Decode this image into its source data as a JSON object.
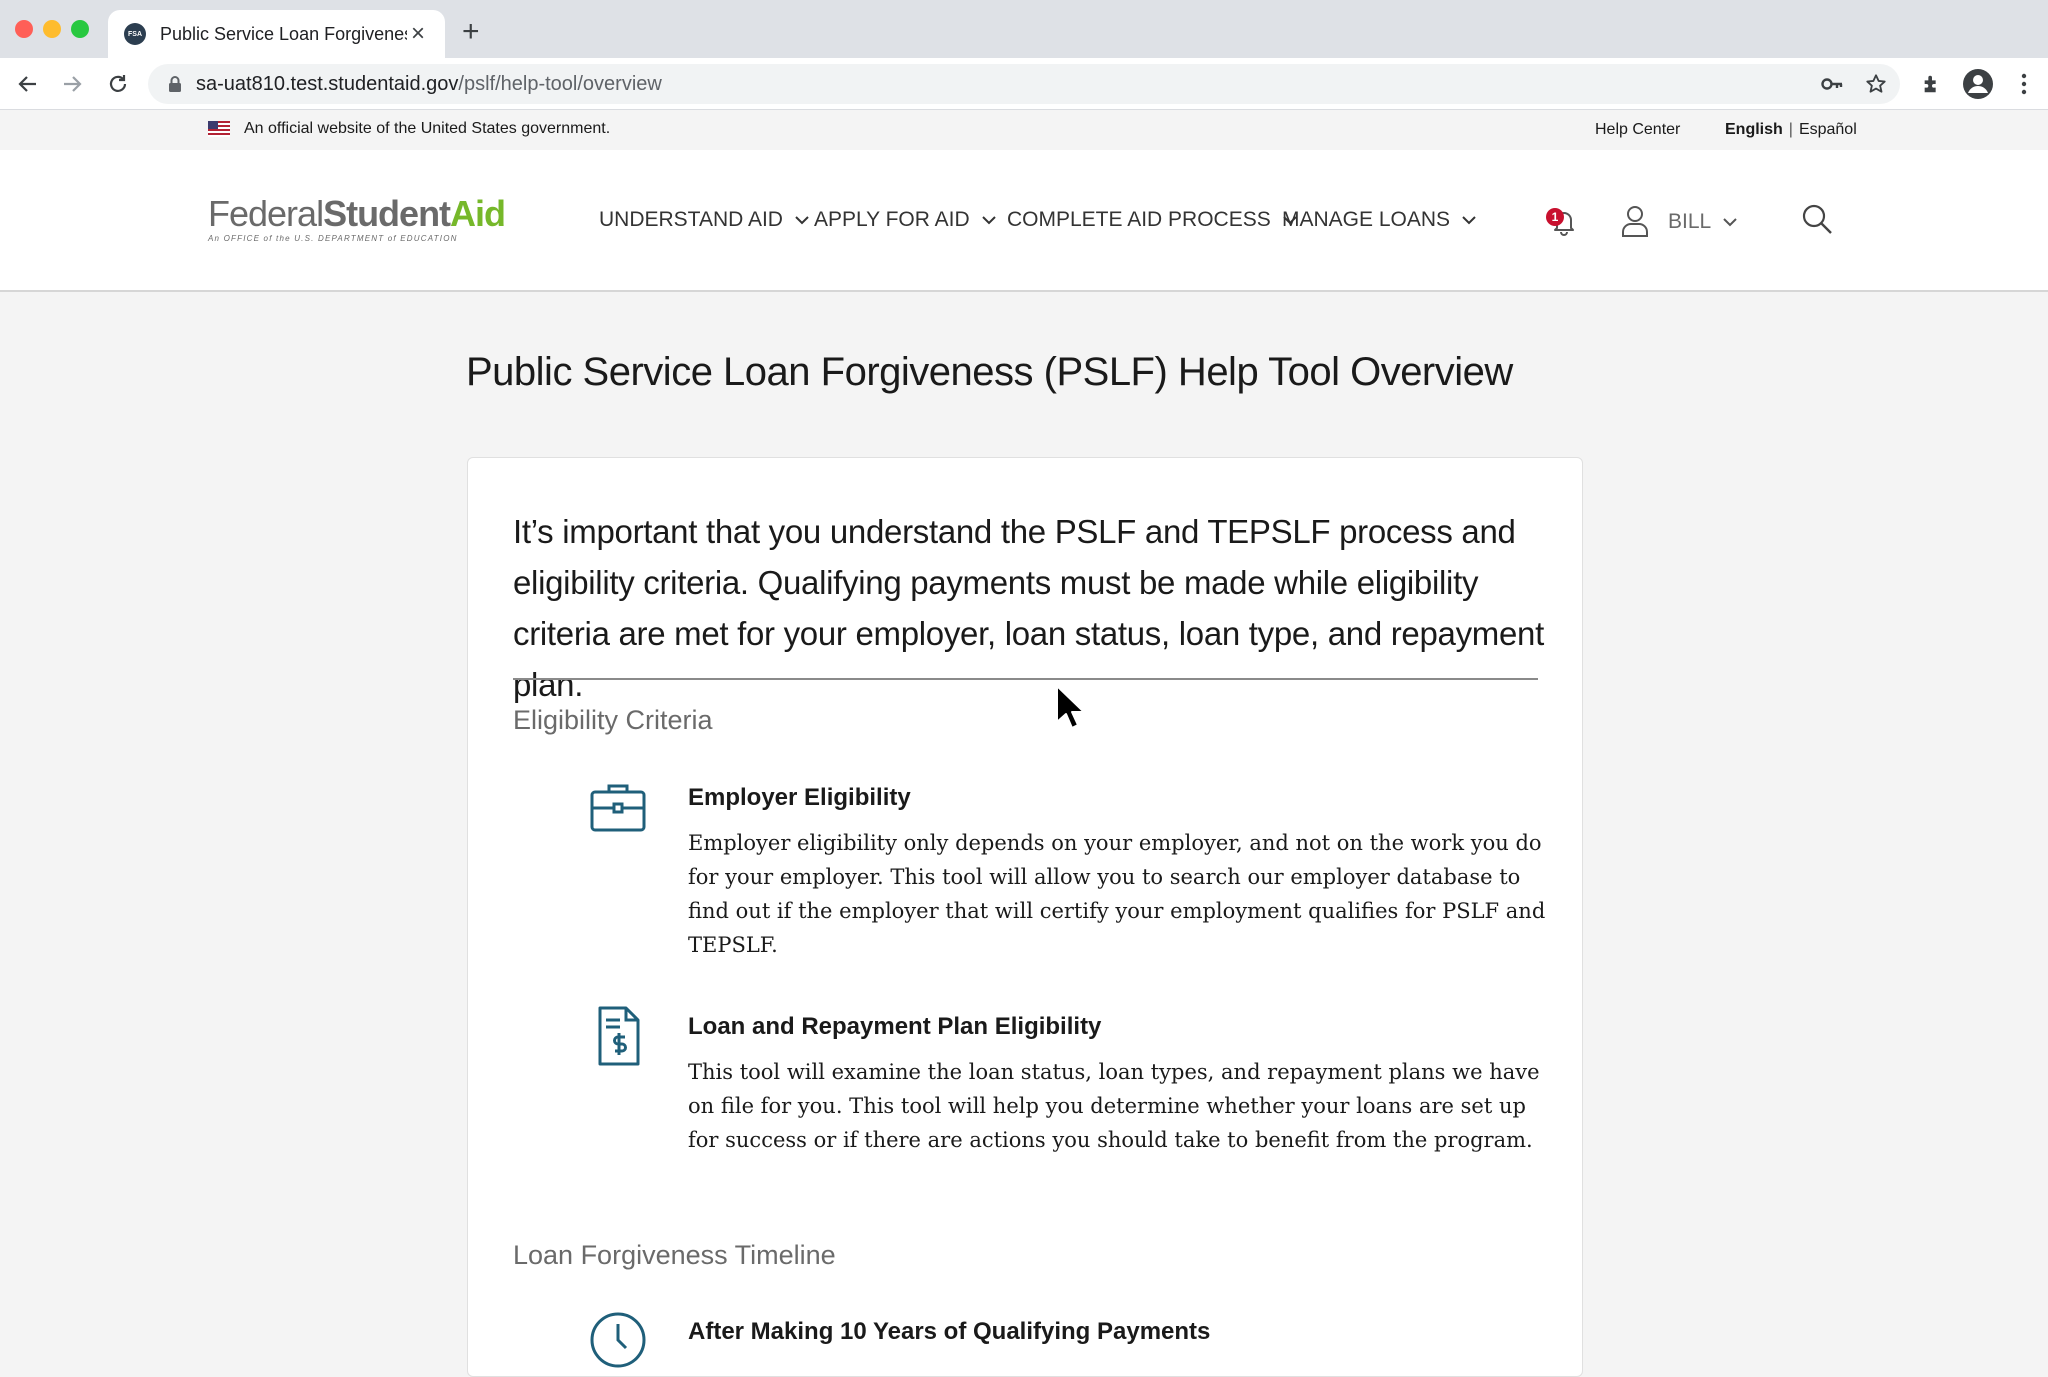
{
  "browser": {
    "tab_title": "Public Service Loan Forgiveness",
    "tab_favicon": "FSA",
    "url_host": "sa-uat810.test.studentaid.gov",
    "url_path": "/pslf/help-tool/overview"
  },
  "gov_banner": {
    "text": "An official website of the United States government.",
    "help_center": "Help Center",
    "lang_english": "English",
    "lang_sep": "|",
    "lang_spanish": "Español"
  },
  "header": {
    "logo_federal": "Federal",
    "logo_student": "Student",
    "logo_aid": "Aid",
    "logo_sub": "An OFFICE of the U.S. DEPARTMENT of EDUCATION",
    "nav": [
      {
        "label": "UNDERSTAND AID"
      },
      {
        "label": "APPLY FOR AID"
      },
      {
        "label": "COMPLETE AID PROCESS"
      },
      {
        "label": "MANAGE LOANS"
      }
    ],
    "notification_count": "1",
    "user_name": "BILL"
  },
  "page": {
    "title": "Public Service Loan Forgiveness (PSLF) Help Tool Overview",
    "intro": "It’s important that you understand the PSLF and TEPSLF process and eligibility criteria. Qualifying payments must be made while eligibility criteria are met for your employer, loan status, loan type, and repayment plan.",
    "eligibility_label": "Eligibility Criteria",
    "employer_title": "Employer Eligibility",
    "employer_body": "Employer eligibility only depends on your employer, and not on the work you do for your employer. This tool will allow you to search our employer database to find out if the employer that will certify your employment qualifies for PSLF and TEPSLF.",
    "loan_title": "Loan and Repayment Plan Eligibility",
    "loan_body": "This tool will examine the loan status, loan types, and repayment plans we have on file for you. This tool will help you determine whether your loans are set up for success or if there are actions you should take to benefit from the program.",
    "timeline_label": "Loan Forgiveness Timeline",
    "timeline_title": "After Making 10 Years of Qualifying Payments"
  },
  "colors": {
    "accent_teal": "#1f5f7a",
    "logo_green": "#76b82a",
    "badge_red": "#c8102e"
  }
}
